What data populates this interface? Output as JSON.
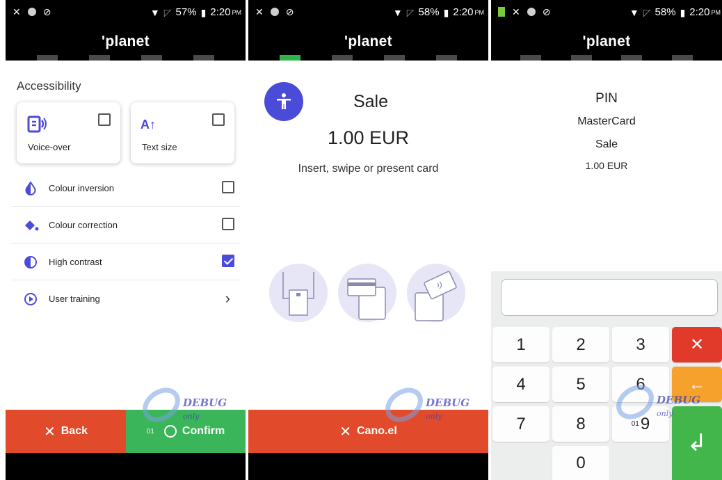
{
  "colors": {
    "accent": "#4b4bd9",
    "cancel_red": "#e14b2b",
    "confirm_green": "#3bb55a",
    "step_active": "#2fb34a"
  },
  "screens": [
    {
      "status": {
        "battery": "57%",
        "time": "2:20",
        "ampm": "PM"
      },
      "brand": "planet",
      "steps_active_index": -1,
      "section_title": "Accessibility",
      "cards": [
        {
          "label": "Voice-over",
          "icon": "voice-over-icon",
          "checked": false
        },
        {
          "label": "Text size",
          "icon_text": "A↑",
          "icon": "text-size-icon",
          "checked": false
        }
      ],
      "options": [
        {
          "label": "Colour inversion",
          "icon": "contrast-drop-icon",
          "checked": false
        },
        {
          "label": "Colour correction",
          "icon": "paint-bucket-icon",
          "checked": false
        },
        {
          "label": "High contrast",
          "icon": "half-circle-icon",
          "checked": true
        },
        {
          "label": "User training",
          "icon": "play-circle-icon",
          "chevron": "›"
        }
      ],
      "footer": {
        "back_label": "Back",
        "confirm_label": "Confirm",
        "confirm_prefix": "01"
      },
      "watermark": {
        "text": "DEBUG",
        "suffix": "only"
      }
    },
    {
      "status": {
        "battery": "58%",
        "time": "2:20",
        "ampm": "PM"
      },
      "brand": "planet",
      "steps_active_index": 0,
      "title": "Sale",
      "amount": "1.00 EUR",
      "hint": "Insert, swipe or present card",
      "card_methods": [
        "insert-card-icon",
        "swipe-card-icon",
        "tap-card-icon"
      ],
      "footer": {
        "cancel_label": "Cano.el"
      },
      "watermark": {
        "text": "DEBUG",
        "suffix": "only"
      }
    },
    {
      "status": {
        "battery": "58%",
        "time": "2:20",
        "ampm": "PM"
      },
      "brand": "planet",
      "steps_active_index": -1,
      "title": "PIN",
      "card_brand": "MasterCard",
      "transaction": "Sale",
      "amount": "1.00 EUR",
      "keypad": {
        "digits": [
          "1",
          "2",
          "3",
          "4",
          "5",
          "6",
          "7",
          "8",
          "9",
          "0"
        ],
        "clear_symbol": "✕",
        "backspace_symbol": "←",
        "enter_symbol": "↲",
        "overlay_prefix": "01"
      },
      "watermark": {
        "text": "DEBUG",
        "suffix": "only"
      }
    }
  ]
}
